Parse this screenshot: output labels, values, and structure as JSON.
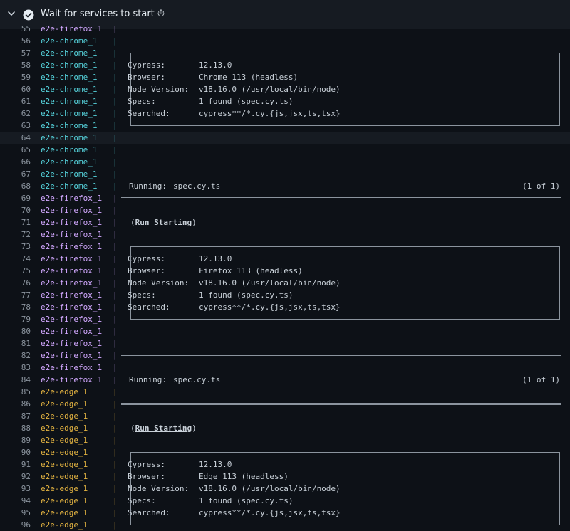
{
  "header": {
    "title": "Wait for services to start ⏱"
  },
  "colors": {
    "background": "#0d1117",
    "header_bg": "#161b22",
    "chrome": "#56d4dd",
    "firefox": "#d2a8ff",
    "edge": "#e3b341",
    "text": "#c9d1d9",
    "line_number": "#8b949e"
  },
  "lines": [
    {
      "n": "55",
      "svc": "e2e-firefox_1",
      "kind": "firefox",
      "type": "blank"
    },
    {
      "n": "56",
      "svc": "e2e-chrome_1",
      "kind": "chrome",
      "type": "blank"
    },
    {
      "n": "57",
      "svc": "e2e-chrome_1",
      "kind": "chrome",
      "type": "box-top"
    },
    {
      "n": "58",
      "svc": "e2e-chrome_1",
      "kind": "chrome",
      "type": "kv",
      "key": "Cypress:",
      "val": "12.13.0"
    },
    {
      "n": "59",
      "svc": "e2e-chrome_1",
      "kind": "chrome",
      "type": "kv",
      "key": "Browser:",
      "val": "Chrome 113 (headless)"
    },
    {
      "n": "60",
      "svc": "e2e-chrome_1",
      "kind": "chrome",
      "type": "kv",
      "key": "Node Version:",
      "val": "v18.16.0 (/usr/local/bin/node)"
    },
    {
      "n": "61",
      "svc": "e2e-chrome_1",
      "kind": "chrome",
      "type": "kv",
      "key": "Specs:",
      "val": "1 found (spec.cy.ts)"
    },
    {
      "n": "62",
      "svc": "e2e-chrome_1",
      "kind": "chrome",
      "type": "kv",
      "key": "Searched:",
      "val": "cypress**/*.cy.{js,jsx,ts,tsx}"
    },
    {
      "n": "63",
      "svc": "e2e-chrome_1",
      "kind": "chrome",
      "type": "box-bottom"
    },
    {
      "n": "64",
      "svc": "e2e-chrome_1",
      "kind": "chrome",
      "type": "blank",
      "highlight": true
    },
    {
      "n": "65",
      "svc": "e2e-chrome_1",
      "kind": "chrome",
      "type": "blank"
    },
    {
      "n": "66",
      "svc": "e2e-chrome_1",
      "kind": "chrome",
      "type": "rule"
    },
    {
      "n": "67",
      "svc": "e2e-chrome_1",
      "kind": "chrome",
      "type": "blank"
    },
    {
      "n": "68",
      "svc": "e2e-chrome_1",
      "kind": "chrome",
      "type": "running",
      "label": "Running:",
      "spec": "spec.cy.ts",
      "count": "(1 of 1)"
    },
    {
      "n": "69",
      "svc": "e2e-firefox_1",
      "kind": "firefox",
      "type": "rule-double"
    },
    {
      "n": "70",
      "svc": "e2e-firefox_1",
      "kind": "firefox",
      "type": "blank"
    },
    {
      "n": "71",
      "svc": "e2e-firefox_1",
      "kind": "firefox",
      "type": "run-starting",
      "text": "Run Starting"
    },
    {
      "n": "72",
      "svc": "e2e-firefox_1",
      "kind": "firefox",
      "type": "blank"
    },
    {
      "n": "73",
      "svc": "e2e-firefox_1",
      "kind": "firefox",
      "type": "box-top"
    },
    {
      "n": "74",
      "svc": "e2e-firefox_1",
      "kind": "firefox",
      "type": "kv",
      "key": "Cypress:",
      "val": "12.13.0"
    },
    {
      "n": "75",
      "svc": "e2e-firefox_1",
      "kind": "firefox",
      "type": "kv",
      "key": "Browser:",
      "val": "Firefox 113 (headless)"
    },
    {
      "n": "76",
      "svc": "e2e-firefox_1",
      "kind": "firefox",
      "type": "kv",
      "key": "Node Version:",
      "val": "v18.16.0 (/usr/local/bin/node)"
    },
    {
      "n": "77",
      "svc": "e2e-firefox_1",
      "kind": "firefox",
      "type": "kv",
      "key": "Specs:",
      "val": "1 found (spec.cy.ts)"
    },
    {
      "n": "78",
      "svc": "e2e-firefox_1",
      "kind": "firefox",
      "type": "kv",
      "key": "Searched:",
      "val": "cypress**/*.cy.{js,jsx,ts,tsx}"
    },
    {
      "n": "79",
      "svc": "e2e-firefox_1",
      "kind": "firefox",
      "type": "box-bottom"
    },
    {
      "n": "80",
      "svc": "e2e-firefox_1",
      "kind": "firefox",
      "type": "blank"
    },
    {
      "n": "81",
      "svc": "e2e-firefox_1",
      "kind": "firefox",
      "type": "blank"
    },
    {
      "n": "82",
      "svc": "e2e-firefox_1",
      "kind": "firefox",
      "type": "rule"
    },
    {
      "n": "83",
      "svc": "e2e-firefox_1",
      "kind": "firefox",
      "type": "blank"
    },
    {
      "n": "84",
      "svc": "e2e-firefox_1",
      "kind": "firefox",
      "type": "running",
      "label": "Running:",
      "spec": "spec.cy.ts",
      "count": "(1 of 1)"
    },
    {
      "n": "85",
      "svc": "e2e-edge_1",
      "kind": "edge",
      "type": "blank"
    },
    {
      "n": "86",
      "svc": "e2e-edge_1",
      "kind": "edge",
      "type": "rule-double"
    },
    {
      "n": "87",
      "svc": "e2e-edge_1",
      "kind": "edge",
      "type": "blank"
    },
    {
      "n": "88",
      "svc": "e2e-edge_1",
      "kind": "edge",
      "type": "run-starting",
      "text": "Run Starting"
    },
    {
      "n": "89",
      "svc": "e2e-edge_1",
      "kind": "edge",
      "type": "blank"
    },
    {
      "n": "90",
      "svc": "e2e-edge_1",
      "kind": "edge",
      "type": "box-top"
    },
    {
      "n": "91",
      "svc": "e2e-edge_1",
      "kind": "edge",
      "type": "kv",
      "key": "Cypress:",
      "val": "12.13.0"
    },
    {
      "n": "92",
      "svc": "e2e-edge_1",
      "kind": "edge",
      "type": "kv",
      "key": "Browser:",
      "val": "Edge 113 (headless)"
    },
    {
      "n": "93",
      "svc": "e2e-edge_1",
      "kind": "edge",
      "type": "kv",
      "key": "Node Version:",
      "val": "v18.16.0 (/usr/local/bin/node)"
    },
    {
      "n": "94",
      "svc": "e2e-edge_1",
      "kind": "edge",
      "type": "kv",
      "key": "Specs:",
      "val": "1 found (spec.cy.ts)"
    },
    {
      "n": "95",
      "svc": "e2e-edge_1",
      "kind": "edge",
      "type": "kv",
      "key": "Searched:",
      "val": "cypress**/*.cy.{js,jsx,ts,tsx}"
    },
    {
      "n": "96",
      "svc": "e2e-edge_1",
      "kind": "edge",
      "type": "box-bottom"
    }
  ]
}
